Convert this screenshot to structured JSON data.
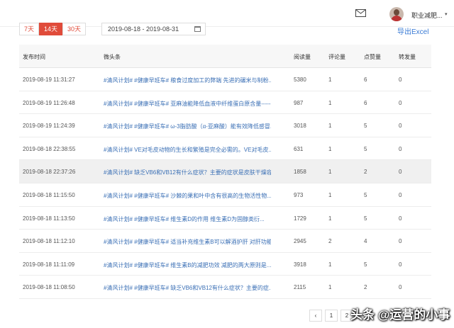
{
  "header": {
    "user_name": "职业减肥...",
    "caret": "▾"
  },
  "filters": {
    "range_tabs": [
      {
        "label": "7天",
        "active": false
      },
      {
        "label": "14天",
        "active": true
      },
      {
        "label": "30天",
        "active": false
      }
    ],
    "date_range": "2019-08-18 - 2019-08-31",
    "export_label": "导出Excel"
  },
  "table": {
    "columns": [
      "发布时间",
      "微头条",
      "阅读量",
      "评论量",
      "点赞量",
      "转发量"
    ],
    "rows": [
      {
        "time": "2019-08-19 11:31:27",
        "title": "#清风计划# #健康早班车# 粮食过度加工的弊端 先进的碾米与制粉...",
        "reads": "5380",
        "comments": "1",
        "likes": "6",
        "shares": "0"
      },
      {
        "time": "2019-08-19 11:26:48",
        "title": "#清风计划# #健康早班车# 亚麻油能降低血液中纤维蛋白原含量-----",
        "reads": "987",
        "comments": "1",
        "likes": "6",
        "shares": "0"
      },
      {
        "time": "2019-08-19 11:24:39",
        "title": "#清风计划# #健康早班车# ω-3脂肪酸（α-亚麻酸）能有效降低感冒...",
        "reads": "3018",
        "comments": "1",
        "likes": "5",
        "shares": "0"
      },
      {
        "time": "2019-08-18 22:38:55",
        "title": "#清风计划# VE对毛皮动物的生长和繁殖是完全必需的。VE对毛皮...",
        "reads": "631",
        "comments": "1",
        "likes": "5",
        "shares": "0"
      },
      {
        "time": "2019-08-18 22:37:26",
        "title": "#清风计划# 缺乏VB6和VB12有什么症状？主要的症状是皮肤干燥容...",
        "reads": "1858",
        "comments": "1",
        "likes": "2",
        "shares": "0"
      },
      {
        "time": "2019-08-18 11:15:50",
        "title": "#清风计划# #健康早班车# 沙棘的果和叶中含有很高的生物活性物...",
        "reads": "973",
        "comments": "1",
        "likes": "5",
        "shares": "0"
      },
      {
        "time": "2019-08-18 11:13:50",
        "title": "#清风计划# #健康早班车# 维生素D的作用        维生素D为固醇类衍...",
        "reads": "1729",
        "comments": "1",
        "likes": "5",
        "shares": "0"
      },
      {
        "time": "2019-08-18 11:12:10",
        "title": "#清风计划# #健康早班车# 适当补充维生素B可以解酒护肝 对肝功能...",
        "reads": "2945",
        "comments": "2",
        "likes": "4",
        "shares": "0"
      },
      {
        "time": "2019-08-18 11:11:09",
        "title": "#清风计划# #健康早班车# 维生素B的减肥功效 减肥的两大原则是...",
        "reads": "3918",
        "comments": "1",
        "likes": "5",
        "shares": "0"
      },
      {
        "time": "2019-08-18 11:08:50",
        "title": "#清风计划# #健康早班车# 缺乏VB6和VB12有什么症状？主要的症...",
        "reads": "2115",
        "comments": "1",
        "likes": "2",
        "shares": "0"
      }
    ]
  },
  "pagination": {
    "prev": "‹",
    "pages": [
      "1",
      "2"
    ]
  },
  "watermark": "头条 @运营的小事"
}
